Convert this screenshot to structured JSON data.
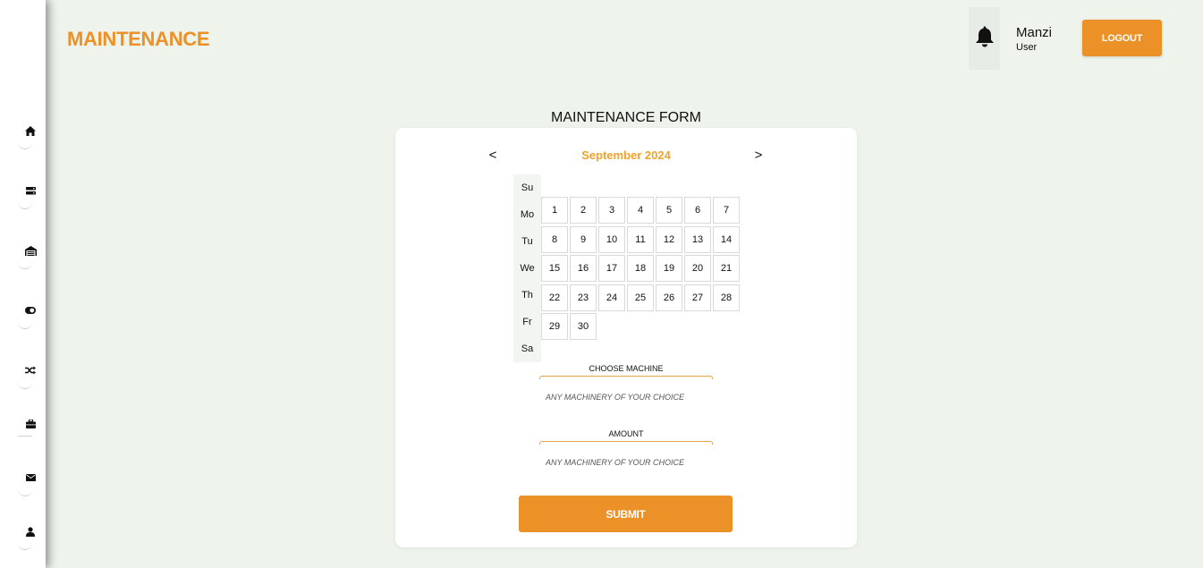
{
  "header": {
    "brand": "MAINTENANCE",
    "user_name": "Manzi",
    "user_role": "User",
    "logout_label": "LOGOUT",
    "bell_icon": "bell-icon"
  },
  "sidebar": {
    "items": [
      {
        "name": "home",
        "icon": "home-icon"
      },
      {
        "name": "server",
        "icon": "server-icon"
      },
      {
        "name": "warehouse",
        "icon": "warehouse-icon"
      },
      {
        "name": "toggle",
        "icon": "toggle-icon"
      },
      {
        "name": "shuffle",
        "icon": "shuffle-icon"
      },
      {
        "name": "briefcase",
        "icon": "briefcase-icon"
      },
      {
        "name": "mail",
        "icon": "envelope-icon"
      },
      {
        "name": "profile",
        "icon": "user-icon"
      }
    ]
  },
  "form": {
    "title": "MAINTENANCE FORM",
    "calendar": {
      "prev": "<",
      "next": ">",
      "month": "September 2024",
      "weekdays": [
        "Su",
        "Mo",
        "Tu",
        "We",
        "Th",
        "Fr",
        "Sa"
      ],
      "days": [
        [
          "1",
          "2",
          "3",
          "4",
          "5",
          "6",
          "7"
        ],
        [
          "8",
          "9",
          "10",
          "11",
          "12",
          "13",
          "14"
        ],
        [
          "15",
          "16",
          "17",
          "18",
          "19",
          "20",
          "21"
        ],
        [
          "22",
          "23",
          "24",
          "25",
          "26",
          "27",
          "28"
        ],
        [
          "29",
          "30"
        ]
      ]
    },
    "machine": {
      "label": "CHOOSE MACHINE",
      "placeholder": "ANY MACHINERY OF YOUR CHOICE"
    },
    "amount": {
      "label": "AMOUNT",
      "placeholder": "ANY MACHINERY OF YOUR CHOICE"
    },
    "submit_label": "SUBMIT"
  },
  "colors": {
    "accent": "#ec9127",
    "month": "#f2a22a",
    "background": "#eef3ec"
  }
}
